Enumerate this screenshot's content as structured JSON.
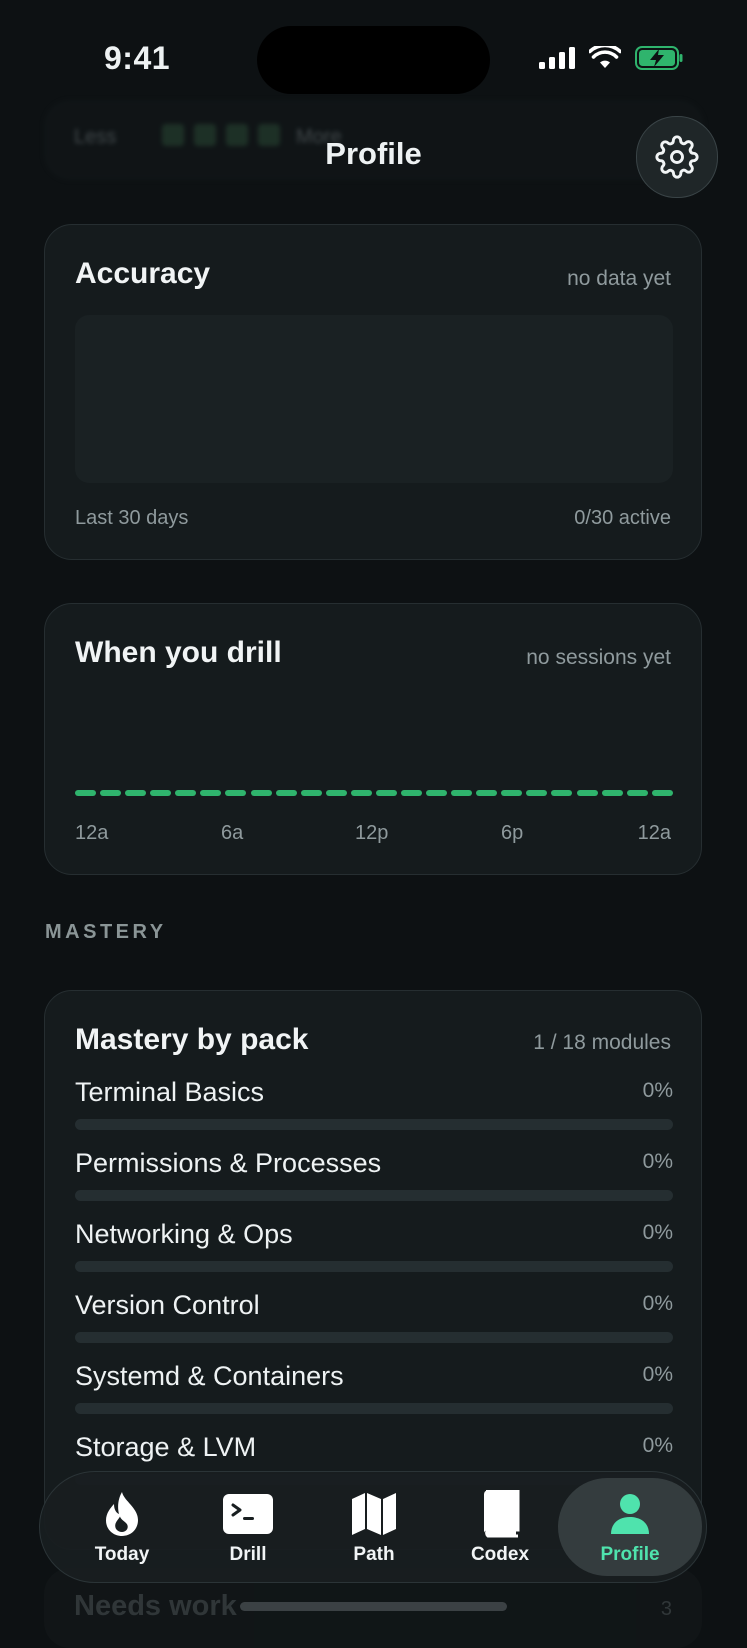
{
  "status_bar": {
    "time": "9:41"
  },
  "header": {
    "title": "Profile"
  },
  "background_card": {
    "label_left": "Less",
    "label_right": "More"
  },
  "accuracy": {
    "title": "Accuracy",
    "status": "no data yet",
    "footer_left": "Last 30 days",
    "footer_right": "0/30 active"
  },
  "drill_times": {
    "title": "When you drill",
    "status": "no sessions yet",
    "labels": [
      "12a",
      "6a",
      "12p",
      "6p",
      "12a"
    ],
    "dash_count": 24
  },
  "mastery": {
    "section_label": "MASTERY",
    "card_title": "Mastery by pack",
    "summary": "1 / 18 modules",
    "packs": [
      {
        "name": "Terminal Basics",
        "percent_label": "0%",
        "progress": 0
      },
      {
        "name": "Permissions & Processes",
        "percent_label": "0%",
        "progress": 0
      },
      {
        "name": "Networking & Ops",
        "percent_label": "0%",
        "progress": 0
      },
      {
        "name": "Version Control",
        "percent_label": "0%",
        "progress": 0
      },
      {
        "name": "Systemd & Containers",
        "percent_label": "0%",
        "progress": 0
      },
      {
        "name": "Storage & LVM",
        "percent_label": "0%",
        "progress": 0
      }
    ]
  },
  "needs_work": {
    "title": "Needs work",
    "count": "3"
  },
  "tabbar": {
    "tabs": [
      {
        "label": "Today",
        "icon": "flame-icon"
      },
      {
        "label": "Drill",
        "icon": "terminal-icon"
      },
      {
        "label": "Path",
        "icon": "map-icon"
      },
      {
        "label": "Codex",
        "icon": "book-icon"
      },
      {
        "label": "Profile",
        "icon": "person-icon"
      }
    ],
    "active": "Profile"
  },
  "colors": {
    "accent": "#2fb46d",
    "active_tab": "#4fe3ad",
    "background": "#0d1113",
    "card": "#151b1d"
  }
}
